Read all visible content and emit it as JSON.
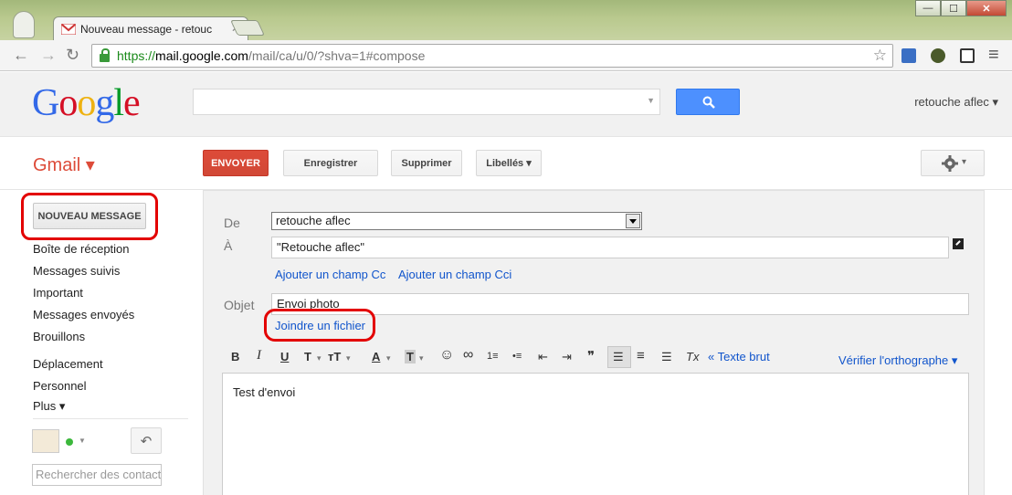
{
  "browser": {
    "tab_title": "Nouveau message - retouc",
    "tab_close": "✕",
    "url_scheme": "https://",
    "url_host": "mail.google.com",
    "url_path": "/mail/ca/u/0/?shva=1#compose",
    "win_min": "—",
    "win_max": "☐",
    "win_close": "✕",
    "back": "←",
    "forward": "→",
    "reload": "↻",
    "star": "☆",
    "menu": "≡"
  },
  "header": {
    "logo": [
      "G",
      "o",
      "o",
      "g",
      "l",
      "e"
    ],
    "search_value": "",
    "search_arrow": "▼",
    "account": "retouche aflec ▾"
  },
  "gmail": {
    "label": "Gmail ▾",
    "send": "ENVOYER",
    "save": "Enregistrer",
    "delete": "Supprimer",
    "labels": "Libellés ▾",
    "gear_arrow": "▾"
  },
  "nav": {
    "compose": "NOUVEAU MESSAGE",
    "items": [
      "Boîte de réception",
      "Messages suivis",
      "Important",
      "Messages envoyés",
      "Brouillons",
      "Déplacement",
      "Personnel",
      "Plus ▾"
    ],
    "status_arrow": "▼",
    "phone": "↶",
    "contact_search_placeholder": "Rechercher des contact"
  },
  "compose": {
    "from_label": "De",
    "from_value": "retouche aflec",
    "to_label": "À",
    "to_value": "\"Retouche aflec\"",
    "add_cc": "Ajouter un champ Cc",
    "add_bcc": "Ajouter un champ Cci",
    "subject_label": "Objet",
    "subject_value": "Envoi photo",
    "attach": "Joindre un fichier",
    "plain_text": "« Texte brut",
    "spellcheck": "Vérifier l'orthographe ▾",
    "body": "Test d'envoi"
  },
  "format_bar": {
    "bold": "B",
    "italic": "I",
    "underline": "U",
    "font": "T",
    "dd1": "▾",
    "size": "тT",
    "dd2": "▾",
    "text_color": "A",
    "dd3": "▾",
    "bg_color": "T",
    "dd4": "▾",
    "emoji": "☺",
    "link": "∞",
    "numbered": "1≡",
    "bulleted": "•≡",
    "outdent": "⇤",
    "indent": "⇥",
    "quote": "❞",
    "align_left": "☰",
    "align_center": "≡",
    "align_right": "☰",
    "clear": "Tx"
  },
  "colors": {
    "send": "#dd4b39",
    "link": "#1155cc",
    "annotation": "#e30000",
    "search_button": "#4d90fe"
  }
}
